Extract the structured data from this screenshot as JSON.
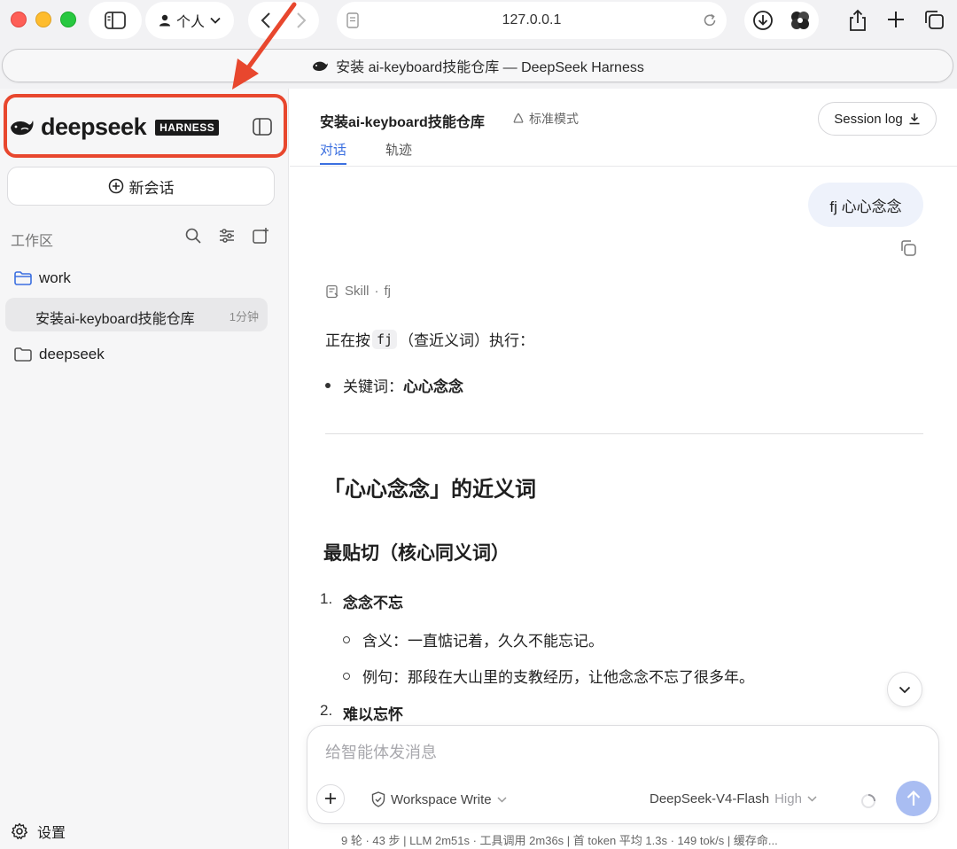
{
  "browser": {
    "profile_label": "个人",
    "url": "127.0.0.1",
    "tab_title": "安装 ai-keyboard技能仓库 — DeepSeek Harness"
  },
  "sidebar": {
    "brand_name": "deepseek",
    "brand_badge": "HARNESS",
    "new_chat_label": "新会话",
    "workspace_label": "工作区",
    "folders": [
      {
        "name": "work"
      },
      {
        "name": "deepseek"
      }
    ],
    "active_session": {
      "title": "安装ai-keyboard技能仓库",
      "time": "1分钟"
    },
    "settings_label": "设置"
  },
  "header": {
    "title": "安装ai-keyboard技能仓库",
    "mode": "标准模式",
    "session_log_label": "Session log",
    "tabs": [
      {
        "label": "对话",
        "active": true
      },
      {
        "label": "轨迹",
        "active": false
      }
    ]
  },
  "conversation": {
    "user_message": "fj 心心念念",
    "skill_label": "Skill",
    "skill_separator": "·",
    "skill_name": "fj",
    "exec_prefix": "正在按",
    "exec_code": "fj",
    "exec_suffix": "（查近义词）执行：",
    "keyword_label": "关键词：",
    "keyword_value": "心心念念",
    "heading": "「心心念念」的近义词",
    "subheading": "最贴切（核心同义词）",
    "items": [
      {
        "num": "1.",
        "term": "念念不忘",
        "meaning": "含义：一直惦记着，久久不能忘记。",
        "example": "例句：那段在大山里的支教经历，让他念念不忘了很多年。"
      },
      {
        "num": "2.",
        "term": "难以忘怀"
      }
    ]
  },
  "composer": {
    "placeholder": "给智能体发消息",
    "permission": "Workspace Write",
    "model": "DeepSeek-V4-Flash",
    "level": "High"
  },
  "status_bar": "9 轮 · 43 步   |   LLM 2m51s · 工具调用 2m36s   |   首 token 平均 1.3s · 149 tok/s   |   缓存命...",
  "colors": {
    "accent": "#3b6fe0",
    "highlight_annotation": "#e8472e",
    "send_button": "#a9bdf2",
    "sidebar_bg": "#f6f6f7"
  }
}
